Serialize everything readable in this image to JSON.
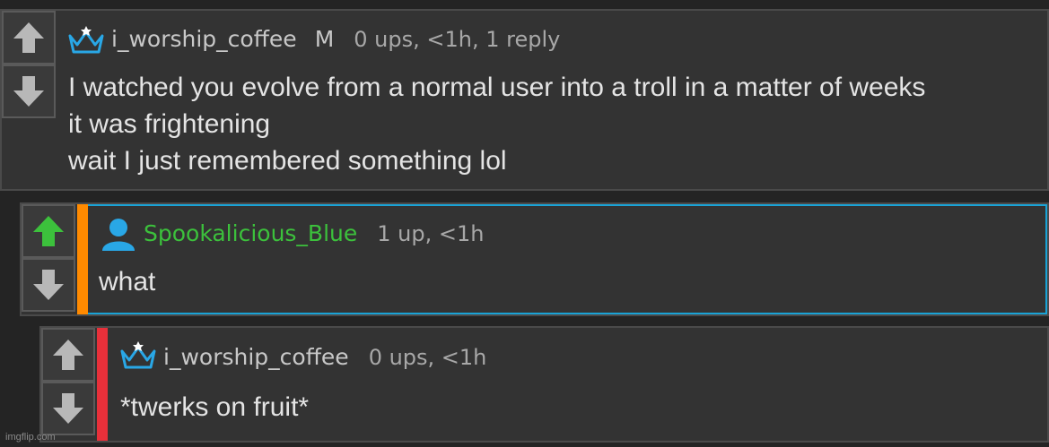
{
  "comments": [
    {
      "username": "i_worship_coffee",
      "badge": "M",
      "stats": "0 ups, <1h, 1 reply",
      "lines": [
        "I watched you evolve from a normal user into a troll in a matter of weeks",
        "it was frightening",
        "wait I just remembered something lol"
      ],
      "icon": "crown-icon",
      "upvoted": false
    },
    {
      "username": "Spookalicious_Blue",
      "stats": "1 up, <1h",
      "lines": [
        "what"
      ],
      "icon": "user-icon",
      "upvoted": true
    },
    {
      "username": "i_worship_coffee",
      "stats": "0 ups, <1h",
      "lines": [
        "*twerks on fruit*"
      ],
      "icon": "crown-icon",
      "upvoted": false
    }
  ],
  "watermark": "imgflip.com",
  "colors": {
    "background": "#242424",
    "panel": "#333333",
    "highlight_border": "#1aa3d6",
    "orange_bar": "#ff8a00",
    "red_bar": "#e8303a",
    "green_username": "#3cc13c",
    "green_arrow": "#3cc13c",
    "icon_blue": "#29a7e6",
    "arrow_gray": "#b8b8b8"
  }
}
